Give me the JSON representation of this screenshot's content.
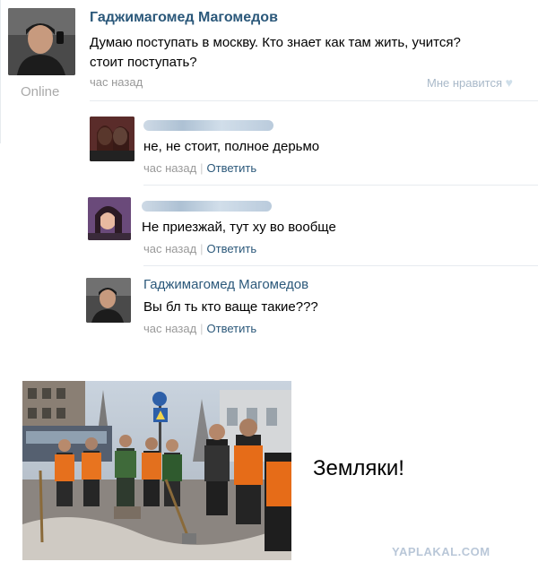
{
  "post": {
    "author": "Гаджимагомед Магомедов",
    "text_line1": "Думаю поступать в москву. Кто знает как там жить, учится?",
    "text_line2": "стоит поступать?",
    "time": "час назад",
    "status": "Online",
    "like_label": "Мне нравится"
  },
  "comments": [
    {
      "author_hidden": true,
      "text": "не, не стоит, полное дерьмо",
      "time": "час назад",
      "reply": "Ответить"
    },
    {
      "author_hidden": true,
      "text": "Не приезжай, тут ху  во вообще",
      "time": "час назад",
      "reply": "Ответить"
    },
    {
      "author": "Гаджимагомед Магомедов",
      "text": "Вы бл  ть кто ваще такие???",
      "time": "час назад",
      "reply": "Ответить"
    }
  ],
  "caption": "Земляки!",
  "watermark": "YAPLAKAL.COM",
  "colors": {
    "link": "#2b587a",
    "muted": "#999999",
    "like_heart": "#cfdfea"
  }
}
